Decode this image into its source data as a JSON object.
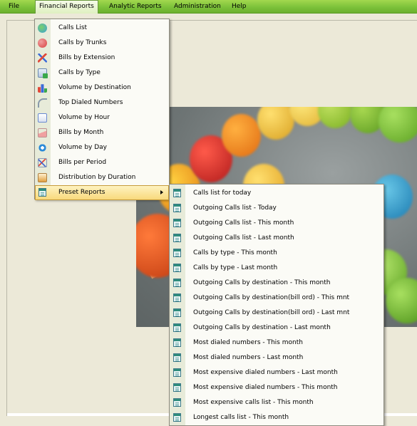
{
  "menubar": {
    "items": [
      {
        "label": "File"
      },
      {
        "label": "Financial Reports"
      },
      {
        "label": "Analytic Reports"
      },
      {
        "label": "Administration"
      },
      {
        "label": "Help"
      }
    ]
  },
  "financial_menu": {
    "items": [
      {
        "label": "Calls List",
        "icon": "pie-chart-icon",
        "color": "#3aa0d8"
      },
      {
        "label": "Calls by Trunks",
        "icon": "stacked-discs-icon",
        "color": "#d84040"
      },
      {
        "label": "Bills by Extension",
        "icon": "line-graph-icon",
        "color": "#e04a3a"
      },
      {
        "label": "Calls by Type",
        "icon": "document-arrow-icon",
        "color": "#3aa84a"
      },
      {
        "label": "Volume by Destination",
        "icon": "bar-chart-icon",
        "color": "#3a6ad8"
      },
      {
        "label": "Top Dialed Numbers",
        "icon": "curve-chart-icon",
        "color": "#8a9aaa"
      },
      {
        "label": "Volume by Hour",
        "icon": "document-chart-icon",
        "color": "#6a8ad0"
      },
      {
        "label": "Bills by Month",
        "icon": "area-chart-icon",
        "color": "#d86a6a"
      },
      {
        "label": "Volume by Day",
        "icon": "arrows-icon",
        "color": "#2a8ad8"
      },
      {
        "label": "Bills per Period",
        "icon": "zigzag-chart-icon",
        "color": "#4a6ad0"
      },
      {
        "label": "Distribution by Duration",
        "icon": "gradient-chart-icon",
        "color": "#e0a040"
      },
      {
        "label": "Preset Reports",
        "icon": "window-icon",
        "color": "#2e8c7c",
        "has_submenu": true
      }
    ]
  },
  "preset_menu": {
    "items": [
      {
        "label": "Calls list for today"
      },
      {
        "label": "Outgoing Calls list - Today"
      },
      {
        "label": "Outgoing Calls list - This month"
      },
      {
        "label": "Outgoing Calls list - Last month"
      },
      {
        "label": "Calls by type - This month"
      },
      {
        "label": "Calls by type - Last month"
      },
      {
        "label": "Outgoing Calls by destination - This month"
      },
      {
        "label": "Outgoing Calls by destination(bill ord) - This mnt"
      },
      {
        "label": "Outgoing Calls by destination(bill ord) - Last mnt"
      },
      {
        "label": "Outgoing Calls by destination - Last month"
      },
      {
        "label": "Most dialed numbers - This month"
      },
      {
        "label": "Most dialed numbers - Last month"
      },
      {
        "label": "Most expensive dialed numbers - Last month"
      },
      {
        "label": "Most expensive dialed numbers - This month"
      },
      {
        "label": "Most expensive calls list - This month"
      },
      {
        "label": "Longest calls list - This month"
      }
    ]
  },
  "colors": {
    "menubar": "#7cc23a",
    "highlight": "#f8d878",
    "background": "#ece9d8"
  }
}
